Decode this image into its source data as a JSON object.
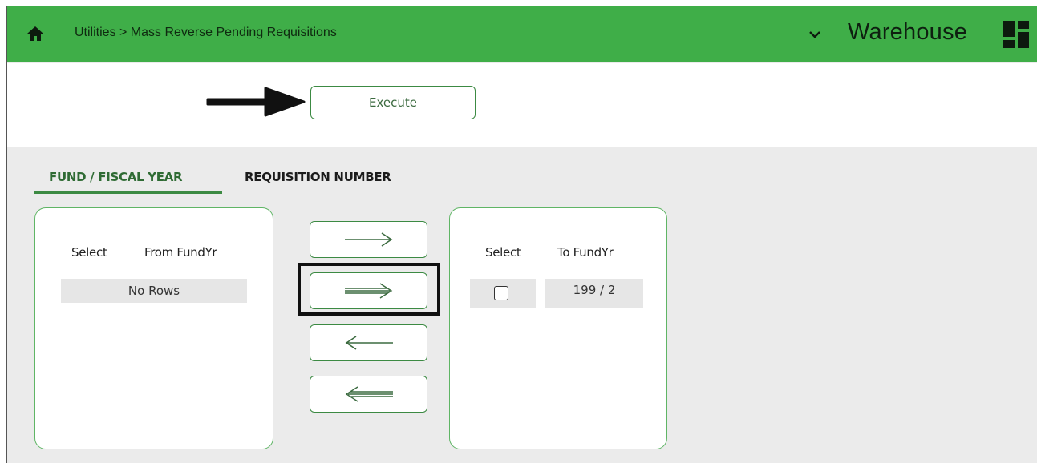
{
  "header": {
    "home_icon": "home-icon",
    "breadcrumb": "Utilities > Mass Reverse Pending Requisitions",
    "app_title": "Warehouse",
    "dropdown_icon": "chevron-down-icon",
    "apps_icon": "grid-icon",
    "bar_color": "#3fae48"
  },
  "toolbar": {
    "execute_label": "Execute",
    "pointer_icon": "arrow-right-icon"
  },
  "tabs": [
    {
      "label": "FUND / FISCAL YEAR",
      "active": true
    },
    {
      "label": "REQUISITION NUMBER",
      "active": false
    }
  ],
  "from_list": {
    "columns": [
      "Select",
      "From FundYr"
    ],
    "empty_text": "No Rows"
  },
  "move_buttons": [
    {
      "icon": "move-selected-right-icon"
    },
    {
      "icon": "move-all-right-icon",
      "highlighted": true
    },
    {
      "icon": "move-selected-left-icon"
    },
    {
      "icon": "move-all-left-icon"
    }
  ],
  "to_list": {
    "columns": [
      "Select",
      "To FundYr"
    ],
    "rows": [
      {
        "selected": false,
        "fund_yr": "199 / 2"
      }
    ]
  },
  "accent_color": "#3c8a43"
}
